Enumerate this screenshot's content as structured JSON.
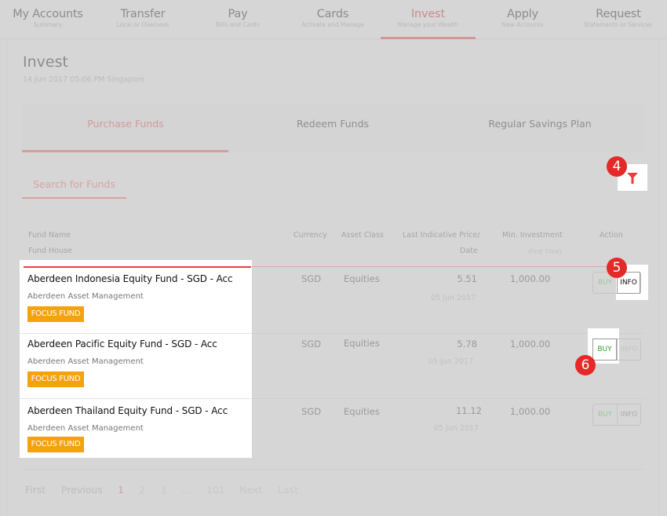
{
  "nav": [
    {
      "title": "My Accounts",
      "subtitle": "Summary"
    },
    {
      "title": "Transfer",
      "subtitle": "Local or Overseas"
    },
    {
      "title": "Pay",
      "subtitle": "Bills and Cards"
    },
    {
      "title": "Cards",
      "subtitle": "Activate and Manage"
    },
    {
      "title": "Invest",
      "subtitle": "Manage your Wealth",
      "active": true
    },
    {
      "title": "Apply",
      "subtitle": "New Accounts"
    },
    {
      "title": "Request",
      "subtitle": "Statements or Services"
    }
  ],
  "page": {
    "title": "Invest",
    "subtitle": "14 Jun 2017 05:06 PM Singapore"
  },
  "tabs": [
    {
      "label": "Purchase Funds",
      "active": true
    },
    {
      "label": "Redeem Funds"
    },
    {
      "label": "Regular Savings Plan"
    }
  ],
  "search": {
    "placeholder": "Search for Funds"
  },
  "filter": {
    "icon": "filter-icon"
  },
  "annotations": {
    "filter": "4",
    "info": "5",
    "buy": "6"
  },
  "table": {
    "headers": {
      "fund_name": "Fund Name",
      "fund_house": "Fund House",
      "currency": "Currency",
      "asset_class": "Asset Class",
      "price_line1": "Last Indicative Price/",
      "price_line2": "Date",
      "min_inv": "Min. Investment",
      "min_inv_note": "(First Time)",
      "action": "Action"
    },
    "rows": [
      {
        "name": "Aberdeen Indonesia Equity Fund - SGD - Acc",
        "house": "Aberdeen Asset Management",
        "badge": "FOCUS FUND",
        "currency": "SGD",
        "asset_class": "Equities",
        "price": "5.51",
        "date": "05 Jun 2017",
        "min_investment": "1,000.00",
        "buy_label": "BUY",
        "info_label": "INFO"
      },
      {
        "name": "Aberdeen Pacific Equity Fund - SGD - Acc",
        "house": "Aberdeen Asset Management",
        "badge": "FOCUS FUND",
        "currency": "SGD",
        "asset_class": "Equities",
        "price": "5.78",
        "date": "05 Jun 2017",
        "min_investment": "1,000.00",
        "buy_label": "BUY",
        "info_label": "INFO"
      },
      {
        "name": "Aberdeen Thailand Equity Fund - SGD - Acc",
        "house": "Aberdeen Asset Management",
        "badge": "FOCUS FUND",
        "currency": "SGD",
        "asset_class": "Equities",
        "price": "11.12",
        "date": "05 Jun 2017",
        "min_investment": "1,000.00",
        "buy_label": "BUY",
        "info_label": "INFO"
      }
    ]
  },
  "pagination": {
    "first": "First",
    "previous": "Previous",
    "pages": [
      "1",
      "2",
      "3"
    ],
    "ellipsis": "...",
    "last_page": "101",
    "next": "Next",
    "last": "Last",
    "current": "1"
  },
  "colors": {
    "accent": "#e52828",
    "focus_badge": "#f5a20f",
    "buy_green": "#2e9e2e"
  }
}
